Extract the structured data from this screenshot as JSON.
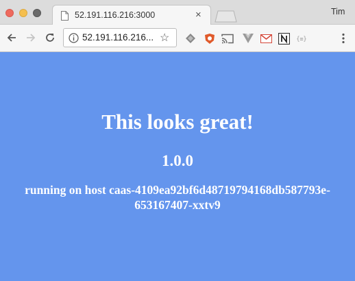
{
  "window": {
    "tab": {
      "title": "52.191.116.216:3000"
    },
    "user_name": "Tim"
  },
  "toolbar": {
    "url": "52.191.116.216...",
    "extensions": [
      "layers-icon",
      "ublock-icon",
      "cast-icon",
      "vue-devtools-icon",
      "gmail-icon",
      "notion-icon",
      "json-viewer-icon"
    ]
  },
  "page": {
    "background": "#6495ed",
    "headline": "This looks great!",
    "version": "1.0.0",
    "host_line1": "running on host caas-4109ea92bf6d48719794168db587793e-",
    "host_line2": "653167407-xxtv9"
  }
}
